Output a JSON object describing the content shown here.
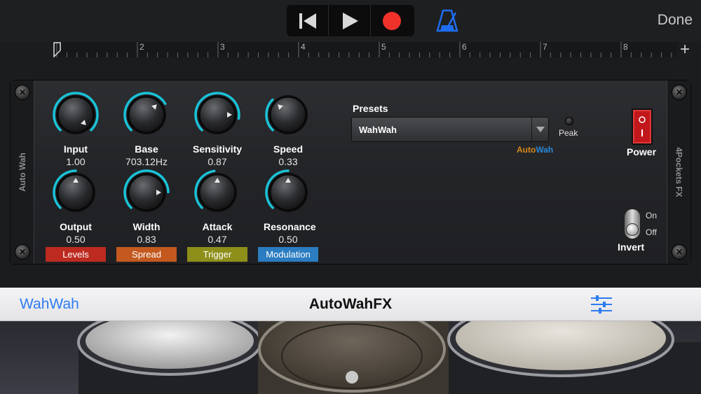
{
  "topbar": {
    "done_label": "Done",
    "ruler_marks": [
      "2",
      "3",
      "4",
      "5",
      "6",
      "7",
      "8"
    ],
    "colors": {
      "record": "#f0322b",
      "metronome": "#1f6df0"
    }
  },
  "plugin": {
    "side_left": "Auto Wah",
    "side_right": "4Pockets FX",
    "knobs": [
      {
        "label": "Input",
        "value": "1.00",
        "level": 1.0,
        "pointer_angle": 135,
        "lit": true
      },
      {
        "label": "Base",
        "value": "703.12Hz",
        "level": 0.72,
        "pointer_angle": 45,
        "lit": true
      },
      {
        "label": "Sensitivity",
        "value": "0.87",
        "level": 0.87,
        "pointer_angle": 90,
        "lit": true
      },
      {
        "label": "Speed",
        "value": "0.33",
        "level": 0.33,
        "pointer_angle": -45,
        "lit": true
      },
      {
        "label": "Output",
        "value": "0.50",
        "level": 0.5,
        "pointer_angle": 0,
        "lit": true
      },
      {
        "label": "Width",
        "value": "0.83",
        "level": 0.83,
        "pointer_angle": 90,
        "lit": true
      },
      {
        "label": "Attack",
        "value": "0.47",
        "level": 0.47,
        "pointer_angle": 0,
        "lit": true
      },
      {
        "label": "Resonance",
        "value": "0.50",
        "level": 0.5,
        "pointer_angle": 0,
        "lit": true
      }
    ],
    "categories": [
      {
        "label": "Levels",
        "color": "#bd2a20"
      },
      {
        "label": "Spread",
        "color": "#c4591f"
      },
      {
        "label": "Trigger",
        "color": "#8e8f1a"
      },
      {
        "label": "Modulation",
        "color": "#2b7cc0"
      }
    ],
    "presets_title": "Presets",
    "preset_value": "WahWah",
    "logo_part1": "Auto",
    "logo_part2": "Wah",
    "peak_label": "Peak",
    "power_label": "Power",
    "invert_on": "On",
    "invert_off": "Off",
    "invert_label": "Invert",
    "accent": "#19c3d8"
  },
  "bottombar": {
    "preset_link": "WahWah",
    "title": "AutoWahFX",
    "link_color": "#2d7cf2"
  }
}
